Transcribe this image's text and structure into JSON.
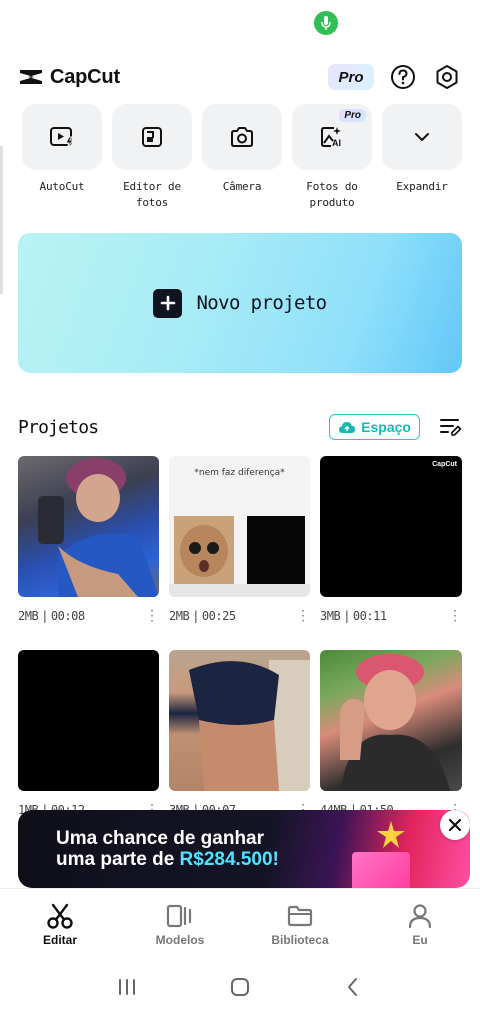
{
  "header": {
    "app_name": "CapCut",
    "pro_label": "Pro"
  },
  "tools": [
    {
      "label": "AutoCut",
      "icon": "autocut-icon"
    },
    {
      "label": "Editor de fotos",
      "icon": "photo-editor-icon"
    },
    {
      "label": "Câmera",
      "icon": "camera-icon"
    },
    {
      "label": "Fotos do produto",
      "icon": "product-photo-icon",
      "badge": "Pro"
    },
    {
      "label": "Expandir",
      "icon": "chevron-down-icon"
    }
  ],
  "new_project": {
    "label": "Novo projeto"
  },
  "projects": {
    "title": "Projetos",
    "space_label": "Espaço",
    "items": [
      {
        "size": "2MB",
        "duration": "00:08"
      },
      {
        "size": "2MB",
        "duration": "00:25",
        "caption": "*nem faz diferença*"
      },
      {
        "size": "3MB",
        "duration": "00:11",
        "watermark": "CapCut"
      },
      {
        "size": "1MB",
        "duration": "00:12"
      },
      {
        "size": "3MB",
        "duration": "00:07"
      },
      {
        "size": "44MB",
        "duration": "01:50"
      }
    ]
  },
  "banner": {
    "line1": "Uma chance de ganhar",
    "line2_prefix": "uma parte de ",
    "amount": "R$284.500!"
  },
  "bottom_nav": [
    {
      "label": "Editar",
      "active": true
    },
    {
      "label": "Modelos",
      "active": false
    },
    {
      "label": "Biblioteca",
      "active": false
    },
    {
      "label": "Eu",
      "active": false
    }
  ],
  "colors": {
    "accent_teal": "#2ec7c0",
    "banner_amount": "#4fe3ff",
    "mic_green": "#2fbf55"
  }
}
